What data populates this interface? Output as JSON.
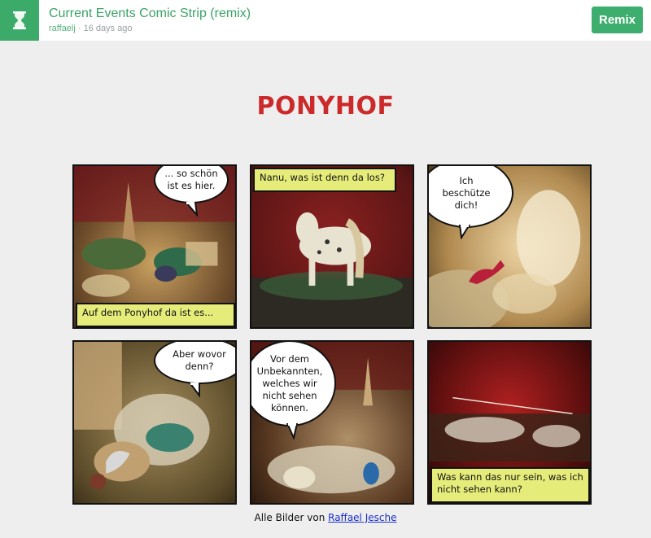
{
  "header": {
    "title": "Current Events Comic Strip (remix)",
    "author": "raffaelj",
    "separator": " · ",
    "age": "16 days ago",
    "remix_label": "Remix"
  },
  "comic": {
    "title": "PONYHOF",
    "panels": [
      {
        "bubble": "... so schön\nist es hier.",
        "caption": "Auf dem Ponyhof da ist es..."
      },
      {
        "caption": "Nanu, was ist denn da los?"
      },
      {
        "bubble": "Ich\nbeschütze\ndich!"
      },
      {
        "bubble": "Aber wovor\ndenn?"
      },
      {
        "bubble": "Vor dem\nUnbekannten,\nwelches wir\nnicht sehen\nkönnen."
      },
      {
        "caption": "Was kann das nur sein, was ich nicht sehen kann?"
      }
    ],
    "credit_prefix": "Alle Bilder von ",
    "credit_link": "Raffael Jesche"
  },
  "colors": {
    "brand_green": "#3cab6a",
    "title_red": "#cc2a2a",
    "caption_yellow": "#e6ec7a"
  }
}
